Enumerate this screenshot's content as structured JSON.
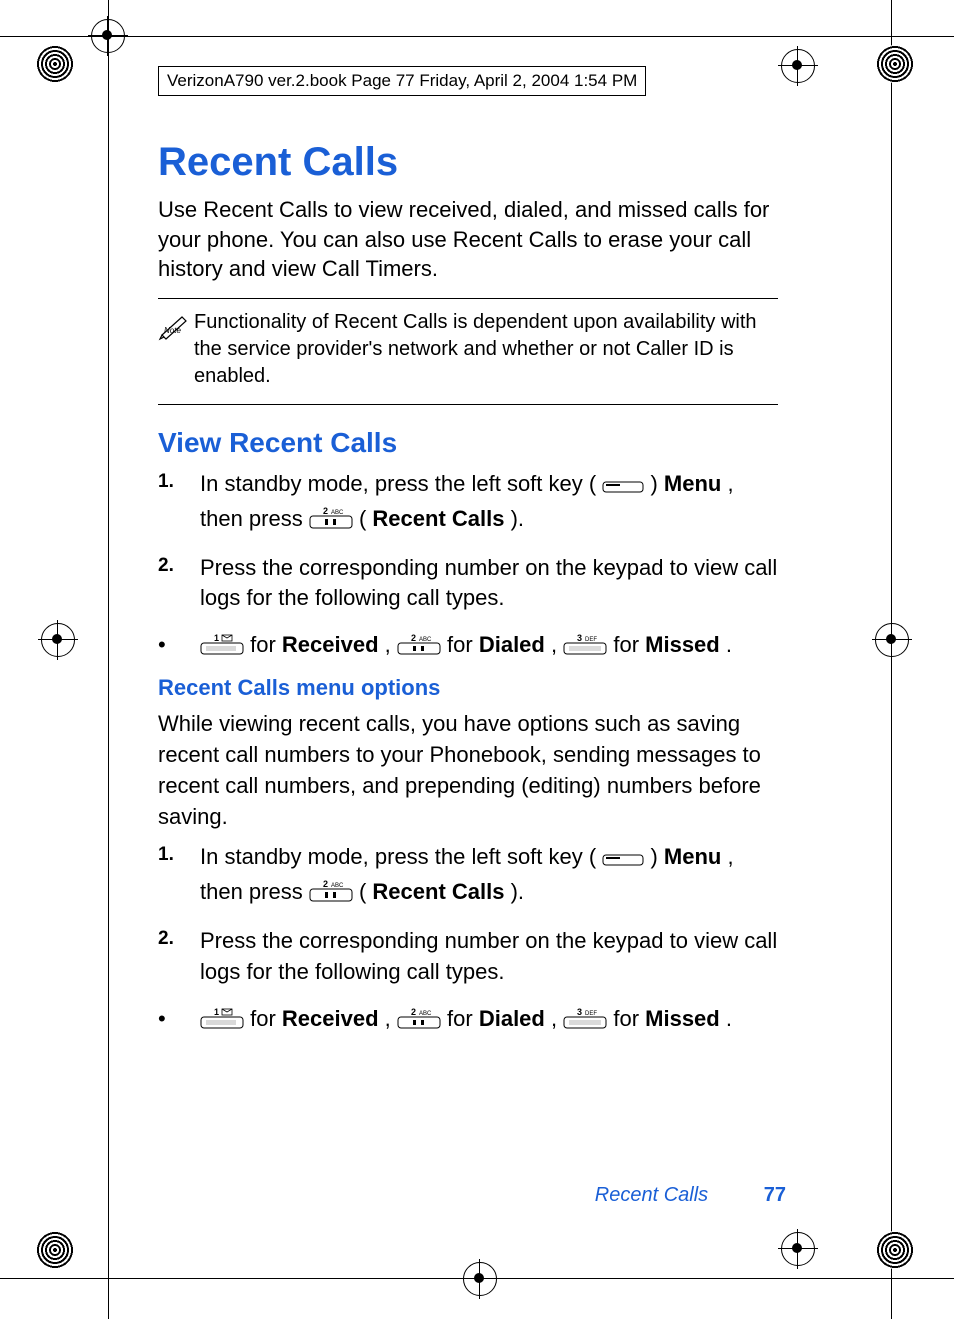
{
  "header_box": "VerizonA790 ver.2.book  Page 77  Friday, April 2, 2004  1:54 PM",
  "title": "Recent Calls",
  "intro": "Use Recent Calls to view received, dialed, and missed calls for your phone. You can also use Recent Calls to erase your call history and view Call Timers.",
  "note": "Functionality of Recent Calls is dependent upon availability with the service provider's network and whether or not Caller ID is enabled.",
  "h2": "View Recent Calls",
  "s1": {
    "n1": "1.",
    "t1a": "In standby mode, press the left soft key ( ",
    "t1b": " ) ",
    "menu": "Menu",
    "t1c": ", then press ",
    "t1d": " (",
    "recent": "Recent Calls",
    "t1e": ").",
    "n2": "2.",
    "t2": "Press the corresponding number on the keypad to view call logs for the following call types.",
    "bl_for1": " for ",
    "received": "Received",
    "sep": ", ",
    "dialed": "Dialed",
    "missed": "Missed",
    "period": "."
  },
  "h3": "Recent Calls menu options",
  "body2": "While viewing recent calls, you have options such as saving recent call numbers to your Phonebook, sending messages to recent call numbers, and prepending (editing) numbers before saving.",
  "footer_label": "Recent Calls",
  "page_number": "77"
}
